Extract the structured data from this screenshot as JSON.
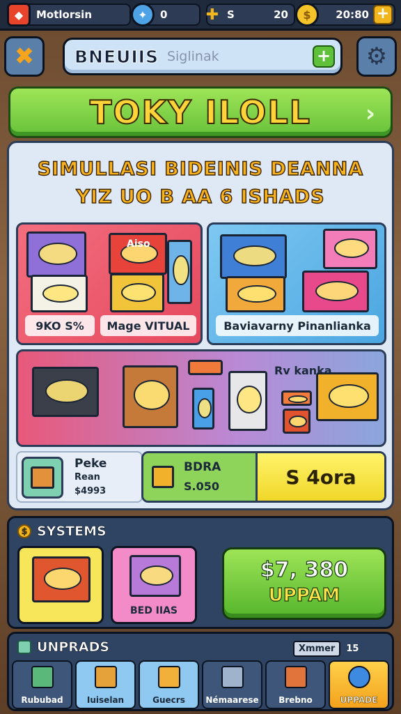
{
  "topbar": {
    "player_name": "Motlorsin",
    "gems": "0",
    "energy_left": "S",
    "energy": "20",
    "coins": "20:80"
  },
  "header": {
    "brand": "BNEUIIS",
    "search_placeholder": "Siglinak"
  },
  "banner": {
    "title": "TOKY ILOLL"
  },
  "panel": {
    "subtitle_line1": "SIMULLASI BIDEINIS DEANNA",
    "subtitle_line2": "YIZ UO B AA 6 ISHADS",
    "card_left": {
      "label1": "9KO S%",
      "label2": "Mage VITUAL",
      "box_text": "Aiso"
    },
    "card_right": {
      "label": "Baviavarny Pinanlianka"
    },
    "card_wide": {
      "label": "Rv kanka"
    },
    "mini": {
      "title": "Peke",
      "sub": "Rean",
      "value": "$4993"
    },
    "price": {
      "title": "BDRA",
      "value": "S.050",
      "amount": "S 4ora"
    }
  },
  "systems": {
    "title": "SYSTEMS",
    "card1_label": "",
    "card2_label": "BED IIAS",
    "upgrade_price": "$7, 380",
    "upgrade_label": "UPPAM"
  },
  "bottom": {
    "title": "UNPRADS",
    "filter_chip": "Xmmer",
    "filter_count": "15",
    "nav": [
      {
        "label": "Rububad"
      },
      {
        "label": "Iuiselan"
      },
      {
        "label": "Guecrs"
      },
      {
        "label": "Némaarese"
      },
      {
        "label": "Brebno"
      },
      {
        "label": "UPPADE"
      }
    ]
  },
  "colors": {
    "banner_green": "#67c23a",
    "title_yellow": "#ffd43a",
    "frame_dark": "#0c1320",
    "upgrade_orange": "#f3a21c"
  }
}
